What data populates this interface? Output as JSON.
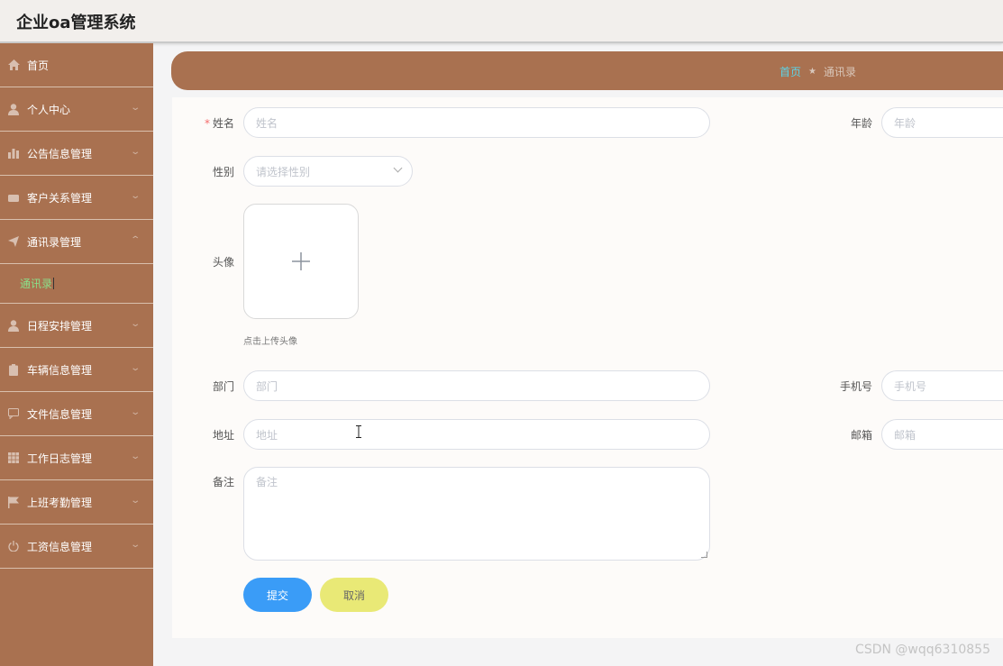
{
  "app": {
    "title": "企业oa管理系统"
  },
  "sidebar": {
    "items": [
      {
        "label": "首页",
        "icon": "home-icon"
      },
      {
        "label": "个人中心",
        "icon": "user-icon"
      },
      {
        "label": "公告信息管理",
        "icon": "bar-chart-icon"
      },
      {
        "label": "客户关系管理",
        "icon": "briefcase-icon"
      },
      {
        "label": "通讯录管理",
        "icon": "send-icon",
        "expanded": true,
        "sub": [
          {
            "label": "通讯录",
            "active": true
          }
        ]
      },
      {
        "label": "日程安排管理",
        "icon": "user-icon"
      },
      {
        "label": "车辆信息管理",
        "icon": "clipboard-icon"
      },
      {
        "label": "文件信息管理",
        "icon": "chat-icon"
      },
      {
        "label": "工作日志管理",
        "icon": "grid-icon"
      },
      {
        "label": "上班考勤管理",
        "icon": "flag-icon"
      },
      {
        "label": "工资信息管理",
        "icon": "power-icon"
      }
    ]
  },
  "breadcrumb": {
    "home": "首页",
    "current": "通讯录"
  },
  "form": {
    "name": {
      "label": "姓名",
      "placeholder": "姓名",
      "required": true
    },
    "age": {
      "label": "年龄",
      "placeholder": "年龄"
    },
    "gender": {
      "label": "性别",
      "placeholder": "请选择性别"
    },
    "avatar": {
      "label": "头像",
      "tip": "点击上传头像"
    },
    "dept": {
      "label": "部门",
      "placeholder": "部门"
    },
    "phone": {
      "label": "手机号",
      "placeholder": "手机号"
    },
    "address": {
      "label": "地址",
      "placeholder": "地址"
    },
    "email": {
      "label": "邮箱",
      "placeholder": "邮箱"
    },
    "remark": {
      "label": "备注",
      "placeholder": "备注"
    },
    "submit_label": "提交",
    "cancel_label": "取消"
  },
  "watermark": "CSDN @wqq6310855",
  "colors": {
    "sidebar": "#a97150",
    "submit": "#3a9cf7",
    "cancel": "#e9e976",
    "active_sub": "#8ae08a",
    "breadcrumb_home": "#5dd3e6"
  }
}
